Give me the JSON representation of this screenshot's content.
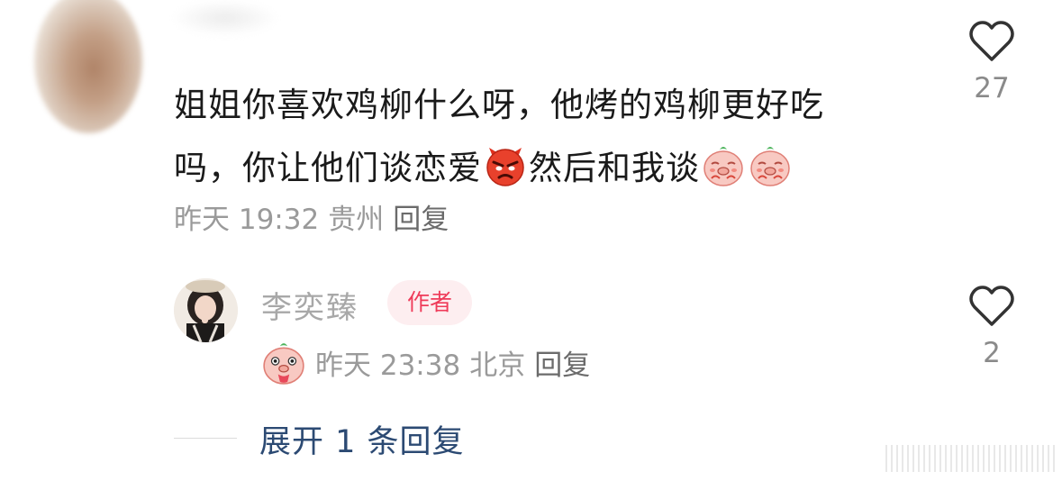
{
  "comment": {
    "line1": "姐姐你喜欢鸡柳什么呀，他烤的鸡柳更好吃",
    "line2_a": "吗，你让他们谈恋爱",
    "line2_b": "然后和我谈",
    "emojis": [
      "angry-face-emoji",
      "pig-pleading-emoji",
      "pig-pleading-emoji"
    ],
    "time": "昨天 19:32",
    "location": "贵州",
    "reply_label": "回复",
    "likes": "27"
  },
  "reply": {
    "author": "李奕臻",
    "badge": "作者",
    "time": "昨天 23:38",
    "location": "北京",
    "reply_label": "回复",
    "likes": "2",
    "emoji": "pig-tongue-emoji"
  },
  "expand": {
    "label": "展开 1 条回复"
  },
  "colors": {
    "badge_bg": "#fdeef0",
    "badge_text": "#ef3b59",
    "expand_text": "#2c4a73",
    "meta_text": "#9a9a9a"
  }
}
